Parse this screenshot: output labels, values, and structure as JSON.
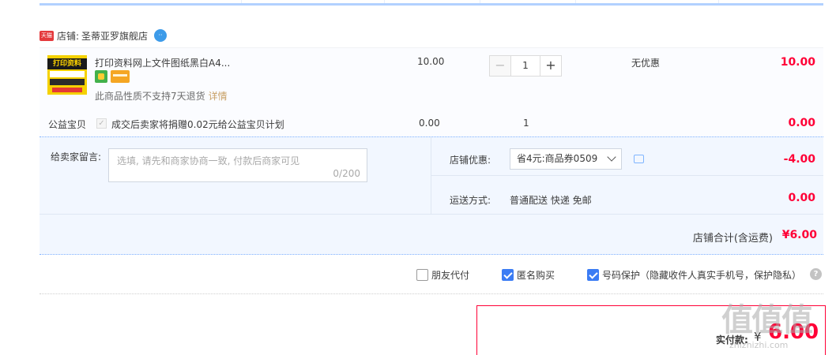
{
  "shop": {
    "label": "店铺:",
    "name": "圣蒂亚罗旗舰店",
    "badge_text": "天猫"
  },
  "item": {
    "thumbnail_text": "打印资料",
    "title": "打印资料网上文件图纸黑白A4...",
    "no_return_note": "此商品性质不支持7天退货",
    "detail_link": "详情",
    "price": "10.00",
    "quantity": "1",
    "qty_minus": "−",
    "qty_plus": "+",
    "promotion": "无优惠",
    "subtotal": "10.00"
  },
  "charity": {
    "label": "公益宝贝",
    "text": "成交后卖家将捐赠0.02元给公益宝贝计划",
    "price": "0.00",
    "quantity": "1",
    "subtotal": "0.00"
  },
  "message": {
    "label": "给卖家留言:",
    "placeholder": "选填, 请先和商家协商一致, 付款后商家可见",
    "counter": "0/200"
  },
  "discount": {
    "label": "店铺优惠:",
    "selected": "省4元:商品券0509",
    "amount": "-4.00"
  },
  "shipping": {
    "label": "运送方式:",
    "value": "普通配送 快递 免邮",
    "amount": "0.00"
  },
  "total": {
    "label": "店铺合计(含运费)",
    "amount": "¥6.00"
  },
  "options": {
    "friend_pay": "朋友代付",
    "anonymous": "匿名购买",
    "number_protect": "号码保护（隐藏收件人真实手机号，保护隐私）",
    "help": "?"
  },
  "payment": {
    "label": "实付款:",
    "currency": "¥",
    "amount": "6.00"
  },
  "watermark": {
    "text": "值值值",
    "url": "zhizhizhi.com"
  }
}
